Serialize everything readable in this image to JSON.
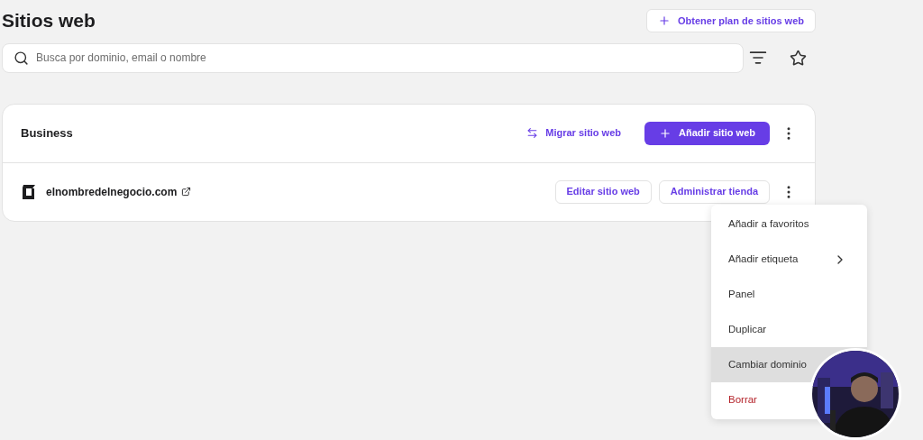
{
  "page": {
    "title": "Sitios web",
    "plan_button": "Obtener plan de sitios web"
  },
  "search": {
    "placeholder": "Busca por dominio, email o nombre"
  },
  "group": {
    "name": "Business",
    "migrate_link": "Migrar sitio web",
    "add_button": "Añadir sitio web"
  },
  "sites": [
    {
      "domain": "elnombredelnegocio.com",
      "buttons": [
        "Editar sitio web",
        "Administrar tienda"
      ]
    }
  ],
  "menu": {
    "items": [
      {
        "label": "Añadir a favoritos",
        "kind": "plain",
        "selected": false
      },
      {
        "label": "Añadir etiqueta",
        "kind": "submenu",
        "selected": false
      },
      {
        "label": "Panel",
        "kind": "plain",
        "selected": false
      },
      {
        "label": "Duplicar",
        "kind": "plain",
        "selected": false
      },
      {
        "label": "Cambiar dominio",
        "kind": "plain",
        "selected": true
      },
      {
        "label": "Borrar",
        "kind": "danger",
        "selected": false
      }
    ]
  }
}
